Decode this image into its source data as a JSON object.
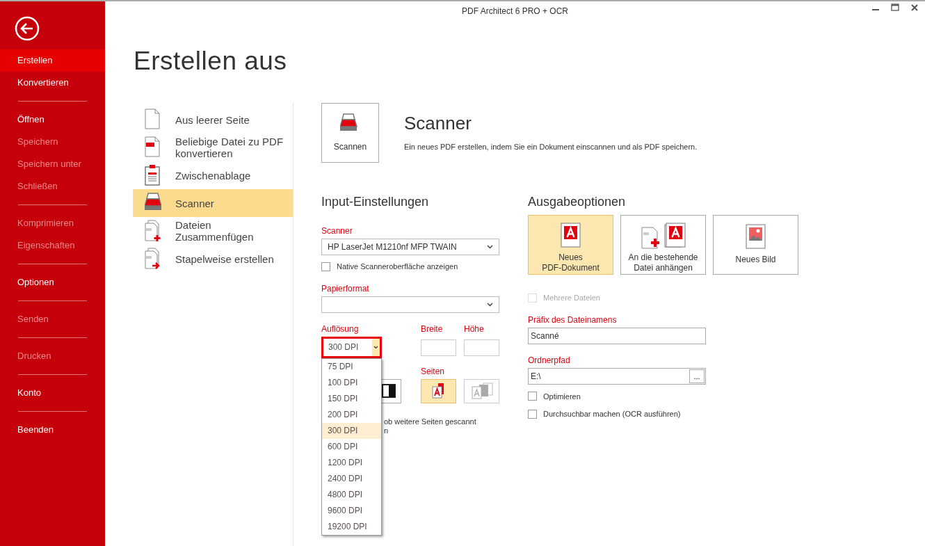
{
  "window": {
    "title": "PDF Architect 6 PRO + OCR"
  },
  "sidebar": {
    "groups": [
      [
        {
          "label": "Erstellen",
          "selected": true,
          "disabled": false
        },
        {
          "label": "Konvertieren",
          "selected": false,
          "disabled": false
        }
      ],
      [
        {
          "label": "Öffnen",
          "selected": false,
          "disabled": false
        },
        {
          "label": "Speichern",
          "selected": false,
          "disabled": true
        },
        {
          "label": "Speichern unter",
          "selected": false,
          "disabled": true
        },
        {
          "label": "Schließen",
          "selected": false,
          "disabled": true
        }
      ],
      [
        {
          "label": "Komprimieren",
          "selected": false,
          "disabled": true
        },
        {
          "label": "Eigenschaften",
          "selected": false,
          "disabled": true
        }
      ],
      [
        {
          "label": "Optionen",
          "selected": false,
          "disabled": false
        }
      ],
      [
        {
          "label": "Senden",
          "selected": false,
          "disabled": true
        }
      ],
      [
        {
          "label": "Drucken",
          "selected": false,
          "disabled": true
        }
      ],
      [
        {
          "label": "Konto",
          "selected": false,
          "disabled": false
        }
      ],
      [
        {
          "label": "Beenden",
          "selected": false,
          "disabled": false
        }
      ]
    ]
  },
  "heading": "Erstellen aus",
  "sources": [
    {
      "kind": "blank",
      "lines": [
        "Aus leerer Seite"
      ],
      "selected": false
    },
    {
      "kind": "convert",
      "lines": [
        "Beliebige Datei zu PDF",
        "konvertieren"
      ],
      "selected": false
    },
    {
      "kind": "clipboard",
      "lines": [
        "Zwischenablage"
      ],
      "selected": false
    },
    {
      "kind": "scanner",
      "lines": [
        "Scanner"
      ],
      "selected": true
    },
    {
      "kind": "merge",
      "lines": [
        "Dateien",
        "Zusammenfügen"
      ],
      "selected": false
    },
    {
      "kind": "batch",
      "lines": [
        "Stapelweise erstellen"
      ],
      "selected": false
    }
  ],
  "action_button": {
    "label": "Scannen"
  },
  "detail": {
    "title": "Scanner",
    "description": "Ein neues PDF erstellen, indem Sie ein Dokument einscannen und als PDF speichern."
  },
  "input_settings": {
    "title": "Input-Einstellungen",
    "scanner": {
      "label": "Scanner",
      "value": "HP LaserJet M1210nf MFP TWAIN"
    },
    "native_ui": {
      "label": "Native Scanneroberfläche anzeigen",
      "checked": false
    },
    "paper_format": {
      "label": "Papierformat"
    },
    "resolution": {
      "label": "Auflösung",
      "value": "300 DPI",
      "expanded": true,
      "options": [
        {
          "label": "75 DPI",
          "selected": false
        },
        {
          "label": "100 DPI",
          "selected": false
        },
        {
          "label": "150 DPI",
          "selected": false
        },
        {
          "label": "200 DPI",
          "selected": false
        },
        {
          "label": "300 DPI",
          "selected": true
        },
        {
          "label": "600 DPI",
          "selected": false
        },
        {
          "label": "1200 DPI",
          "selected": false
        },
        {
          "label": "2400 DPI",
          "selected": false
        },
        {
          "label": "4800 DPI",
          "selected": false
        },
        {
          "label": "9600 DPI",
          "selected": false
        },
        {
          "label": "19200 DPI",
          "selected": false
        }
      ]
    },
    "width": {
      "label": "Breite"
    },
    "height": {
      "label": "Höhe"
    },
    "color_modes": [
      {
        "kind": "bw",
        "selected": false
      }
    ],
    "pages": {
      "label": "Seiten",
      "buttons": [
        {
          "kind": "single",
          "selected": true
        },
        {
          "kind": "multi",
          "selected": false
        }
      ]
    },
    "hidden_option_text": [
      "ob weitere Seiten gescannt",
      "n"
    ]
  },
  "output": {
    "title": "Ausgabeoptionen",
    "targets": [
      {
        "kind": "new_pdf",
        "lines": [
          "Neues",
          "PDF-Dokument"
        ],
        "selected": true
      },
      {
        "kind": "append",
        "lines": [
          "An die bestehende",
          "Datei anhängen"
        ],
        "selected": false
      },
      {
        "kind": "image",
        "lines": [
          "Neues Bild"
        ],
        "selected": false
      }
    ],
    "multiple_files": {
      "label": "Mehrere Dateien",
      "checked": false,
      "disabled": true
    },
    "prefix": {
      "label": "Präfix des Dateinamens",
      "value": "Scanné"
    },
    "folder": {
      "label": "Ordnerpfad",
      "value": "E:\\",
      "browse": "..."
    },
    "options": [
      {
        "label": "Optimieren",
        "checked": false
      },
      {
        "label": "Durchsuchbar machen (OCR ausführen)",
        "checked": false
      }
    ]
  }
}
